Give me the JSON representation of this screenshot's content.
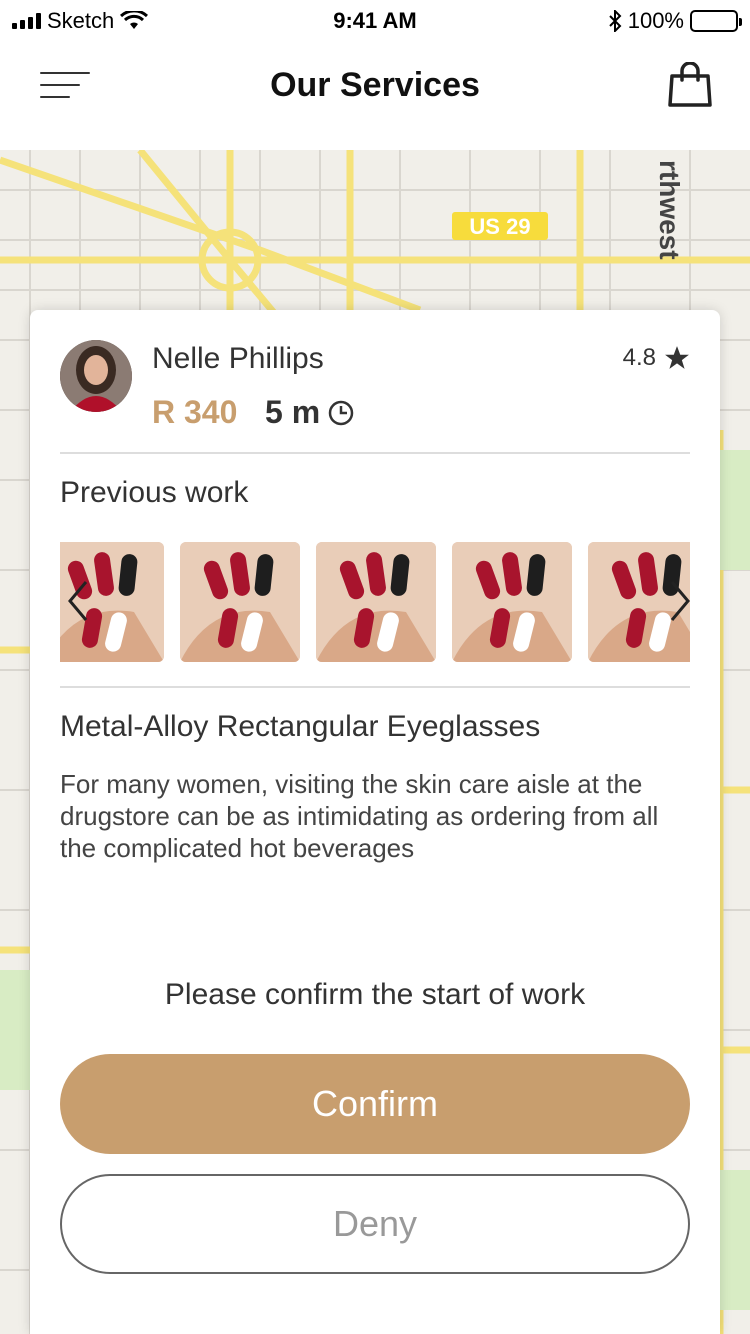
{
  "status_bar": {
    "carrier": "Sketch",
    "time": "9:41 AM",
    "battery": "100%"
  },
  "nav": {
    "title": "Our Services",
    "menu_icon": "menu-icon",
    "cart_icon": "shopping-bag-icon"
  },
  "map": {
    "route_sign": "US 29",
    "street_label": "rthwest"
  },
  "provider": {
    "name": "Nelle Phillips",
    "price": "R 340",
    "duration": "5 m",
    "rating": "4.8"
  },
  "previous_work": {
    "title": "Previous work",
    "images": [
      "nail-art",
      "nail-art",
      "nail-art",
      "nail-art",
      "nail-art"
    ]
  },
  "product": {
    "title": "Metal-Alloy Rectangular Eyeglasses",
    "description": "For many women, visiting the skin care aisle at the drugstore can be as intimidating as ordering from all the complicated hot beverages"
  },
  "confirm_prompt": "Please confirm the start of work",
  "buttons": {
    "confirm": "Confirm",
    "deny": "Deny"
  },
  "colors": {
    "accent": "#c89e6e",
    "map_road": "#f5e27a",
    "map_bg": "#f1efe9"
  }
}
